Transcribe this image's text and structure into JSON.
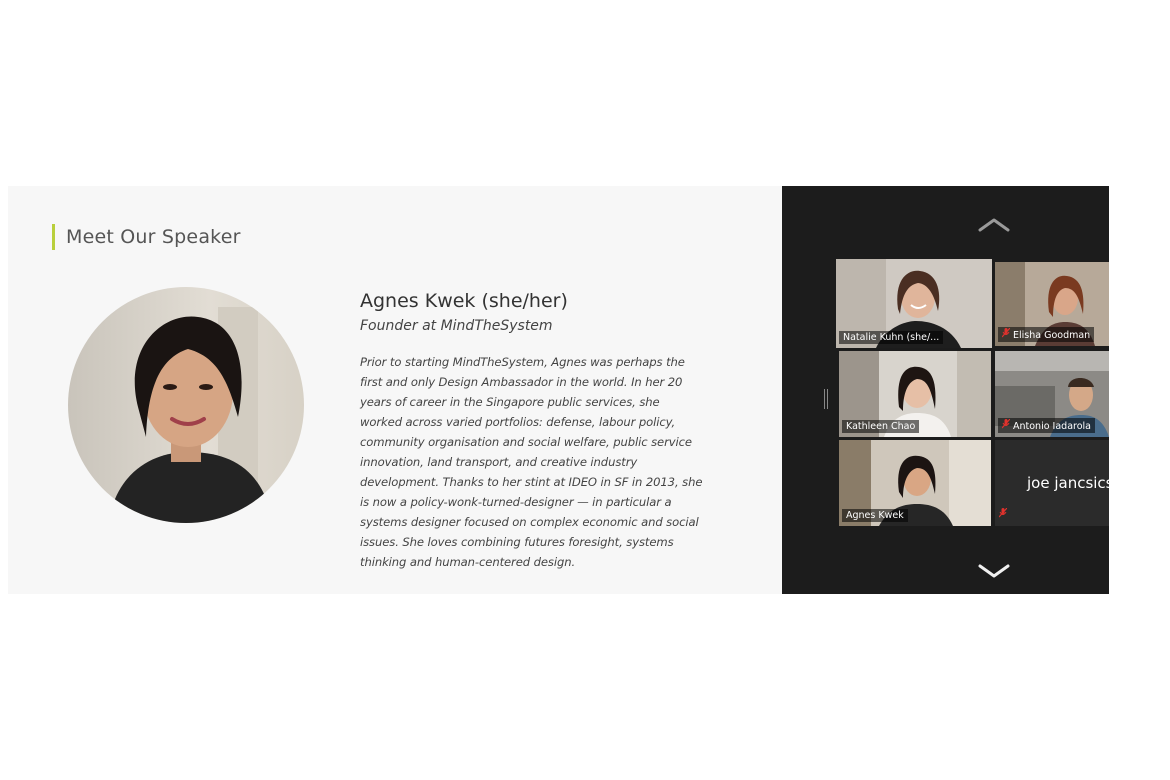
{
  "slide": {
    "heading": "Meet Our Speaker",
    "speaker_name": "Agnes Kwek (she/her)",
    "speaker_role": "Founder at MindTheSystem",
    "speaker_bio": "Prior to starting MindTheSystem, Agnes was perhaps the first and only Design Ambassador in the world. In her 20 years of career in the Singapore public services, she worked across varied portfolios: defense, labour policy, community organisation and social welfare, public service innovation, land transport, and creative industry development. Thanks to her stint at IDEO in SF in 2013, she is now a policy-wonk-turned-designer — in particular a systems designer focused on complex economic and social issues. She loves combining futures foresight, systems thinking and human-centered design.",
    "accent_color": "#b9cf3c"
  },
  "zoom": {
    "participants": [
      {
        "name": "Natalie Kuhn (she/...",
        "muted": false,
        "active_speaker": true
      },
      {
        "name": "Elisha Goodman",
        "muted": true,
        "active_speaker": false
      },
      {
        "name": "Kathleen Chao",
        "muted": false,
        "active_speaker": false
      },
      {
        "name": "Antonio Iadarola",
        "muted": true,
        "active_speaker": false
      },
      {
        "name": "Agnes Kwek",
        "muted": false,
        "active_speaker": false
      },
      {
        "name": "joe jancsics",
        "muted": true,
        "active_speaker": false,
        "video_off": true
      }
    ],
    "icons": {
      "scroll_up": "chevron-up-icon",
      "scroll_down": "chevron-down-icon",
      "mute": "microphone-muted-icon"
    },
    "active_speaker_color": "#c6e06a",
    "mute_color": "#e0322d"
  }
}
